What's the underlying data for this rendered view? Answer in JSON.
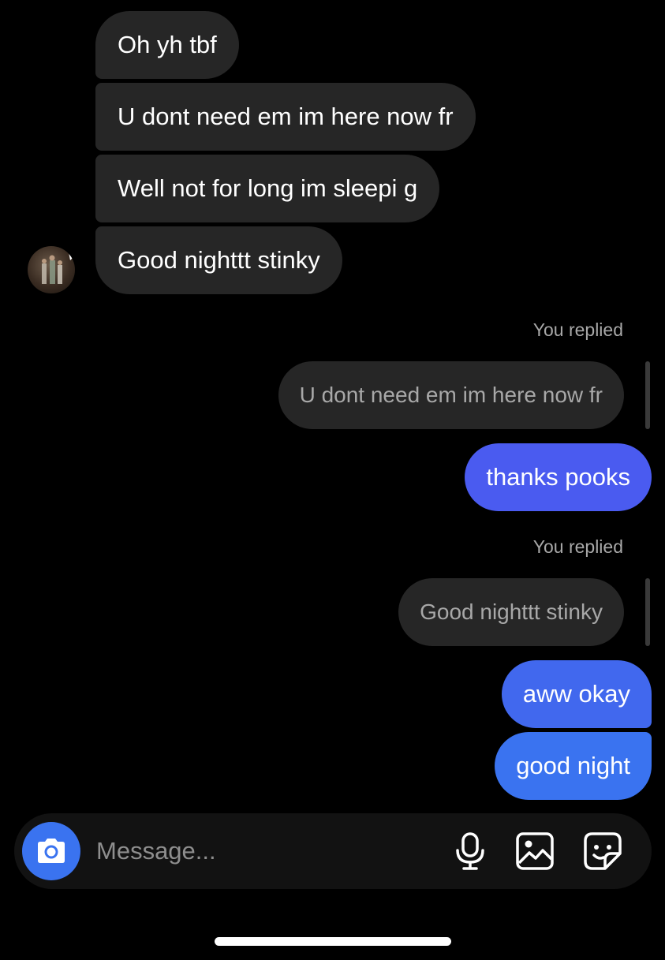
{
  "conversation": {
    "incoming": [
      {
        "text": "Oh yh tbf"
      },
      {
        "text": "U dont need em im here now fr"
      },
      {
        "text": "Well not for long im sleepi g"
      },
      {
        "text": "Good nighttt stinky"
      }
    ],
    "replies": [
      {
        "label": "You replied",
        "quoted": "U dont need em im here now fr",
        "messages": [
          {
            "text": "thanks pooks"
          }
        ]
      },
      {
        "label": "You replied",
        "quoted": "Good nighttt stinky",
        "messages": [
          {
            "text": "aww okay"
          },
          {
            "text": "good night"
          }
        ]
      }
    ]
  },
  "composer": {
    "placeholder": "Message...",
    "icons": [
      "camera-icon",
      "microphone-icon",
      "gallery-icon",
      "sticker-icon"
    ]
  },
  "colors": {
    "incoming_bubble": "#262626",
    "outgoing_gradient_start": "#4a5bf0",
    "outgoing_gradient_end": "#3a73f0",
    "camera_button": "#3a73f0",
    "background": "#000000"
  }
}
